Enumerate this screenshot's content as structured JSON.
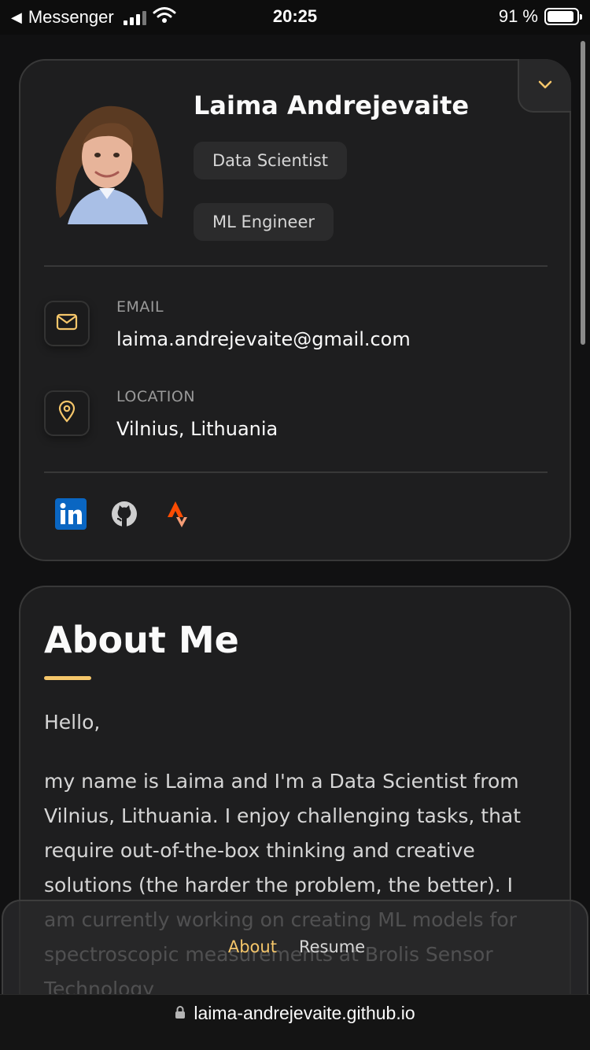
{
  "status_bar": {
    "back_app": "Messenger",
    "time": "20:25",
    "battery": "91 %"
  },
  "profile": {
    "name": "Laima Andrejevaite",
    "titles": [
      "Data Scientist",
      "ML Engineer"
    ],
    "contacts": [
      {
        "label": "EMAIL",
        "value": "laima.andrejevaite@gmail.com",
        "icon": "mail-icon"
      },
      {
        "label": "LOCATION",
        "value": "Vilnius, Lithuania",
        "icon": "location-pin-icon"
      }
    ],
    "socials": [
      {
        "name": "linkedin-icon"
      },
      {
        "name": "github-icon"
      },
      {
        "name": "strava-icon"
      }
    ]
  },
  "about": {
    "heading": "About Me",
    "greeting": "Hello,",
    "body": "my name is Laima and I'm a Data Scientist from Vilnius, Lithuania. I enjoy challenging tasks, that require out-of-the-box thinking and creative solutions (the harder the problem, the better). I am currently working on creating ML models for spectroscopic measurements at Brolis Sensor Technology"
  },
  "nav": {
    "items": [
      "About",
      "Resume"
    ],
    "active": "About"
  },
  "url_bar": {
    "url": "laima-andrejevaite.github.io"
  },
  "colors": {
    "accent": "#f5c66a",
    "background": "#111112",
    "card": "#1e1e1f",
    "strava": "#fc4c02",
    "linkedin": "#0a66c2"
  }
}
